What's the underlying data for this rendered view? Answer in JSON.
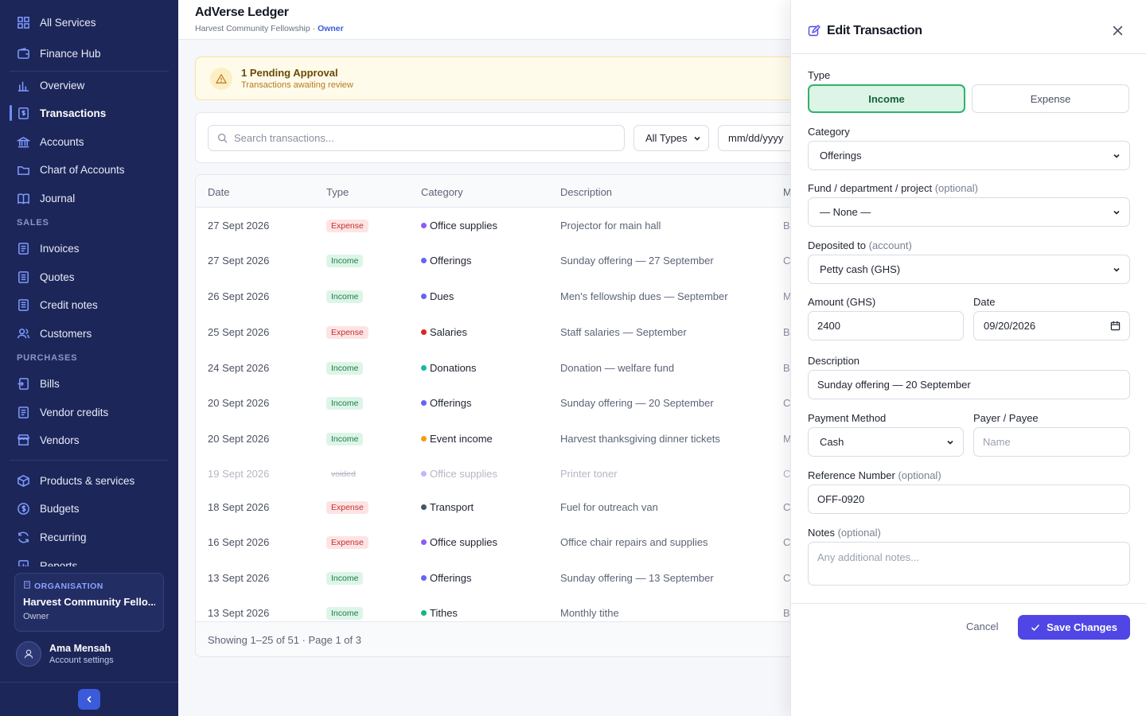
{
  "sidebar": {
    "top": [
      {
        "label": "All Services",
        "icon": "grid-icon"
      },
      {
        "label": "Finance Hub",
        "icon": "wallet-icon"
      }
    ],
    "main": [
      {
        "label": "Overview",
        "icon": "bar-chart-icon"
      },
      {
        "label": "Transactions",
        "icon": "dollar-receipt-icon",
        "active": true
      },
      {
        "label": "Accounts",
        "icon": "bank-icon"
      },
      {
        "label": "Chart of Accounts",
        "icon": "folder-icon"
      },
      {
        "label": "Journal",
        "icon": "book-icon"
      }
    ],
    "sales_title": "SALES",
    "sales": [
      {
        "label": "Invoices",
        "icon": "invoice-icon"
      },
      {
        "label": "Quotes",
        "icon": "quote-icon"
      },
      {
        "label": "Credit notes",
        "icon": "credit-note-icon"
      },
      {
        "label": "Customers",
        "icon": "users-icon"
      }
    ],
    "purchases_title": "PURCHASES",
    "purchases": [
      {
        "label": "Bills",
        "icon": "bill-icon"
      },
      {
        "label": "Vendor credits",
        "icon": "vendor-credit-icon"
      },
      {
        "label": "Vendors",
        "icon": "store-icon"
      }
    ],
    "more": [
      {
        "label": "Products & services",
        "icon": "box-icon"
      },
      {
        "label": "Budgets",
        "icon": "budget-icon"
      },
      {
        "label": "Recurring",
        "icon": "refresh-icon"
      },
      {
        "label": "Reports",
        "icon": "report-icon"
      }
    ],
    "org": {
      "label": "ORGANISATION",
      "name": "Harvest Community Fello...",
      "role": "Owner"
    },
    "user": {
      "name": "Ama Mensah",
      "sub": "Account settings"
    }
  },
  "header": {
    "title": "AdVerse Ledger",
    "org": "Harvest Community Fellowship",
    "separator": " · ",
    "role": "Owner"
  },
  "pending": {
    "title": "1 Pending Approval",
    "subtitle": "Transactions awaiting review"
  },
  "filters": {
    "search_placeholder": "Search transactions...",
    "type_value": "All Types",
    "date_placeholder": "mm/dd/yyyy"
  },
  "table": {
    "columns": [
      "Date",
      "Type",
      "Category",
      "Description",
      "M"
    ],
    "rows": [
      {
        "date": "27 Sept 2026",
        "type": "Expense",
        "category": "Office supplies",
        "dot": "#8b5cf6",
        "description": "Projector for main hall",
        "m": "Ba"
      },
      {
        "date": "27 Sept 2026",
        "type": "Income",
        "category": "Offerings",
        "dot": "#6366f1",
        "description": "Sunday offering — 27 September",
        "m": "C"
      },
      {
        "date": "26 Sept 2026",
        "type": "Income",
        "category": "Dues",
        "dot": "#6366f1",
        "description": "Men's fellowship dues — September",
        "m": "M"
      },
      {
        "date": "25 Sept 2026",
        "type": "Expense",
        "category": "Salaries",
        "dot": "#dc2626",
        "description": "Staff salaries — September",
        "m": "Ba"
      },
      {
        "date": "24 Sept 2026",
        "type": "Income",
        "category": "Donations",
        "dot": "#14b8a6",
        "description": "Donation — welfare fund",
        "m": "Ba"
      },
      {
        "date": "20 Sept 2026",
        "type": "Income",
        "category": "Offerings",
        "dot": "#6366f1",
        "description": "Sunday offering — 20 September",
        "m": "C"
      },
      {
        "date": "20 Sept 2026",
        "type": "Income",
        "category": "Event income",
        "dot": "#f59e0b",
        "description": "Harvest thanksgiving dinner tickets",
        "m": "M"
      },
      {
        "date": "19 Sept 2026",
        "type": "voided",
        "category": "Office supplies",
        "dot": "#c4b5fd",
        "description": "Printer toner",
        "m": "C",
        "voided": true
      },
      {
        "date": "18 Sept 2026",
        "type": "Expense",
        "category": "Transport",
        "dot": "#475569",
        "description": "Fuel for outreach van",
        "m": "C"
      },
      {
        "date": "16 Sept 2026",
        "type": "Expense",
        "category": "Office supplies",
        "dot": "#8b5cf6",
        "description": "Office chair repairs and supplies",
        "m": "C"
      },
      {
        "date": "13 Sept 2026",
        "type": "Income",
        "category": "Offerings",
        "dot": "#6366f1",
        "description": "Sunday offering — 13 September",
        "m": "C"
      },
      {
        "date": "13 Sept 2026",
        "type": "Income",
        "category": "Tithes",
        "dot": "#10b981",
        "description": "Monthly tithe",
        "m": "Ba"
      }
    ],
    "footer": "Showing 1–25 of 51 · Page 1 of 3"
  },
  "drawer": {
    "title": "Edit Transaction",
    "type_label": "Type",
    "type_income": "Income",
    "type_expense": "Expense",
    "category_label": "Category",
    "category_value": "Offerings",
    "fund_label": "Fund / department / project",
    "fund_optional": "(optional)",
    "fund_value": "— None —",
    "deposited_label": "Deposited to",
    "deposited_hint": "(account)",
    "deposited_value": "Petty cash (GHS)",
    "amount_label": "Amount (GHS)",
    "amount_value": "2400",
    "date_label": "Date",
    "date_value": "09/20/2026",
    "description_label": "Description",
    "description_value": "Sunday offering — 20 September",
    "payment_label": "Payment Method",
    "payment_value": "Cash",
    "payee_label": "Payer / Payee",
    "payee_placeholder": "Name",
    "reference_label": "Reference Number",
    "reference_optional": "(optional)",
    "reference_value": "OFF-0920",
    "notes_label": "Notes",
    "notes_optional": "(optional)",
    "notes_placeholder": "Any additional notes...",
    "cancel": "Cancel",
    "save": "Save Changes"
  },
  "colors": {
    "sidebar": "#1c2659",
    "accent": "#4f46e5",
    "income": "#dcf5e7",
    "expense": "#fde4e4"
  }
}
